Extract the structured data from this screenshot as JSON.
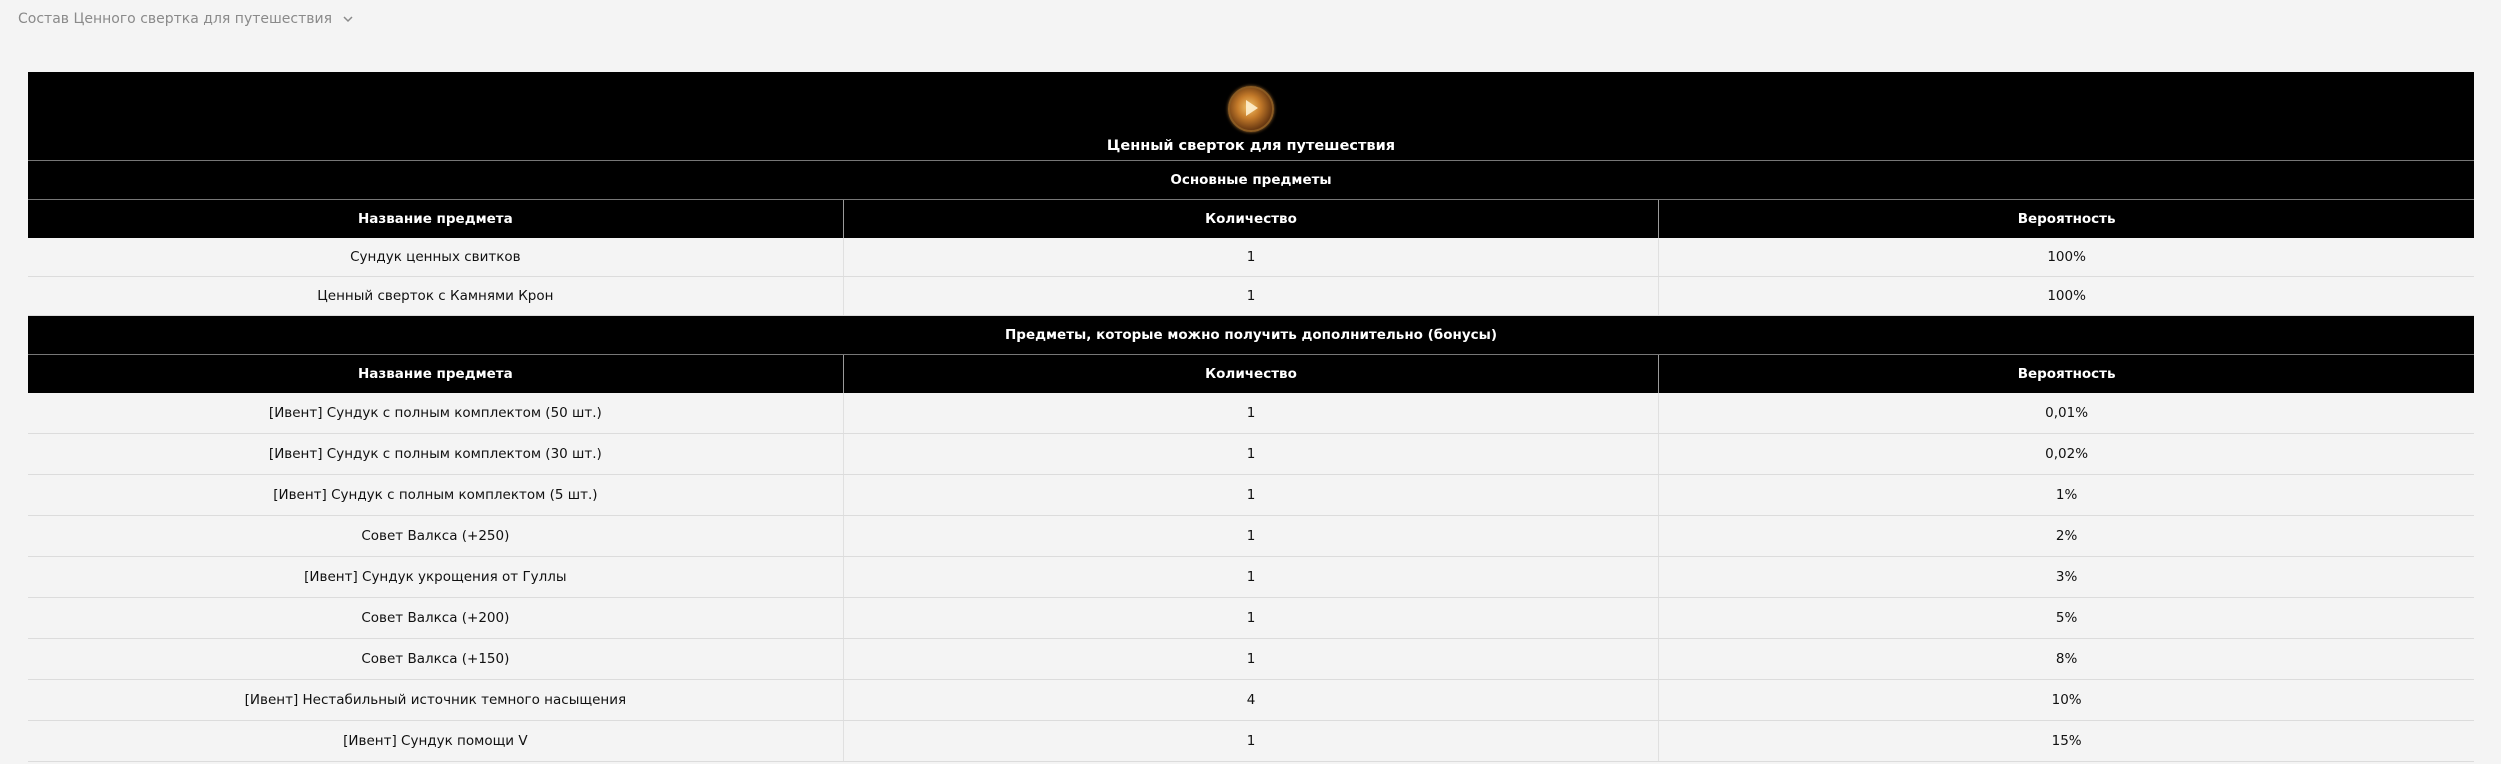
{
  "breadcrumb": {
    "title": "Состав Ценного свертка для путешествия"
  },
  "table": {
    "title": "Ценный сверток для путешествия",
    "columns": [
      "Название предмета",
      "Количество",
      "Вероятность"
    ],
    "main_section": {
      "label": "Основные предметы",
      "rows": [
        {
          "name": "Сундук ценных свитков",
          "qty": "1",
          "prob": "100%"
        },
        {
          "name": "Ценный сверток с Камнями Крон",
          "qty": "1",
          "prob": "100%"
        }
      ]
    },
    "bonus_section": {
      "label": "Предметы, которые можно получить дополнительно (бонусы)",
      "rows": [
        {
          "name": "[Ивент] Сундук с полным комплектом (50 шт.)",
          "qty": "1",
          "prob": "0,01%"
        },
        {
          "name": "[Ивент] Сундук с полным комплектом (30 шт.)",
          "qty": "1",
          "prob": "0,02%"
        },
        {
          "name": "[Ивент] Сундук с полным комплектом (5 шт.)",
          "qty": "1",
          "prob": "1%"
        },
        {
          "name": "Совет Валкса (+250)",
          "qty": "1",
          "prob": "2%"
        },
        {
          "name": "[Ивент] Сундук укрощения от Гуллы",
          "qty": "1",
          "prob": "3%"
        },
        {
          "name": "Совет Валкса (+200)",
          "qty": "1",
          "prob": "5%"
        },
        {
          "name": "Совет Валкса (+150)",
          "qty": "1",
          "prob": "8%"
        },
        {
          "name": "[Ивент] Нестабильный источник темного насыщения",
          "qty": "4",
          "prob": "10%"
        },
        {
          "name": "[Ивент] Сундук помощи V",
          "qty": "1",
          "prob": "15%"
        }
      ]
    }
  },
  "icons": {
    "dropdown": "chevron-down-icon",
    "item": "item-emblem-icon"
  }
}
